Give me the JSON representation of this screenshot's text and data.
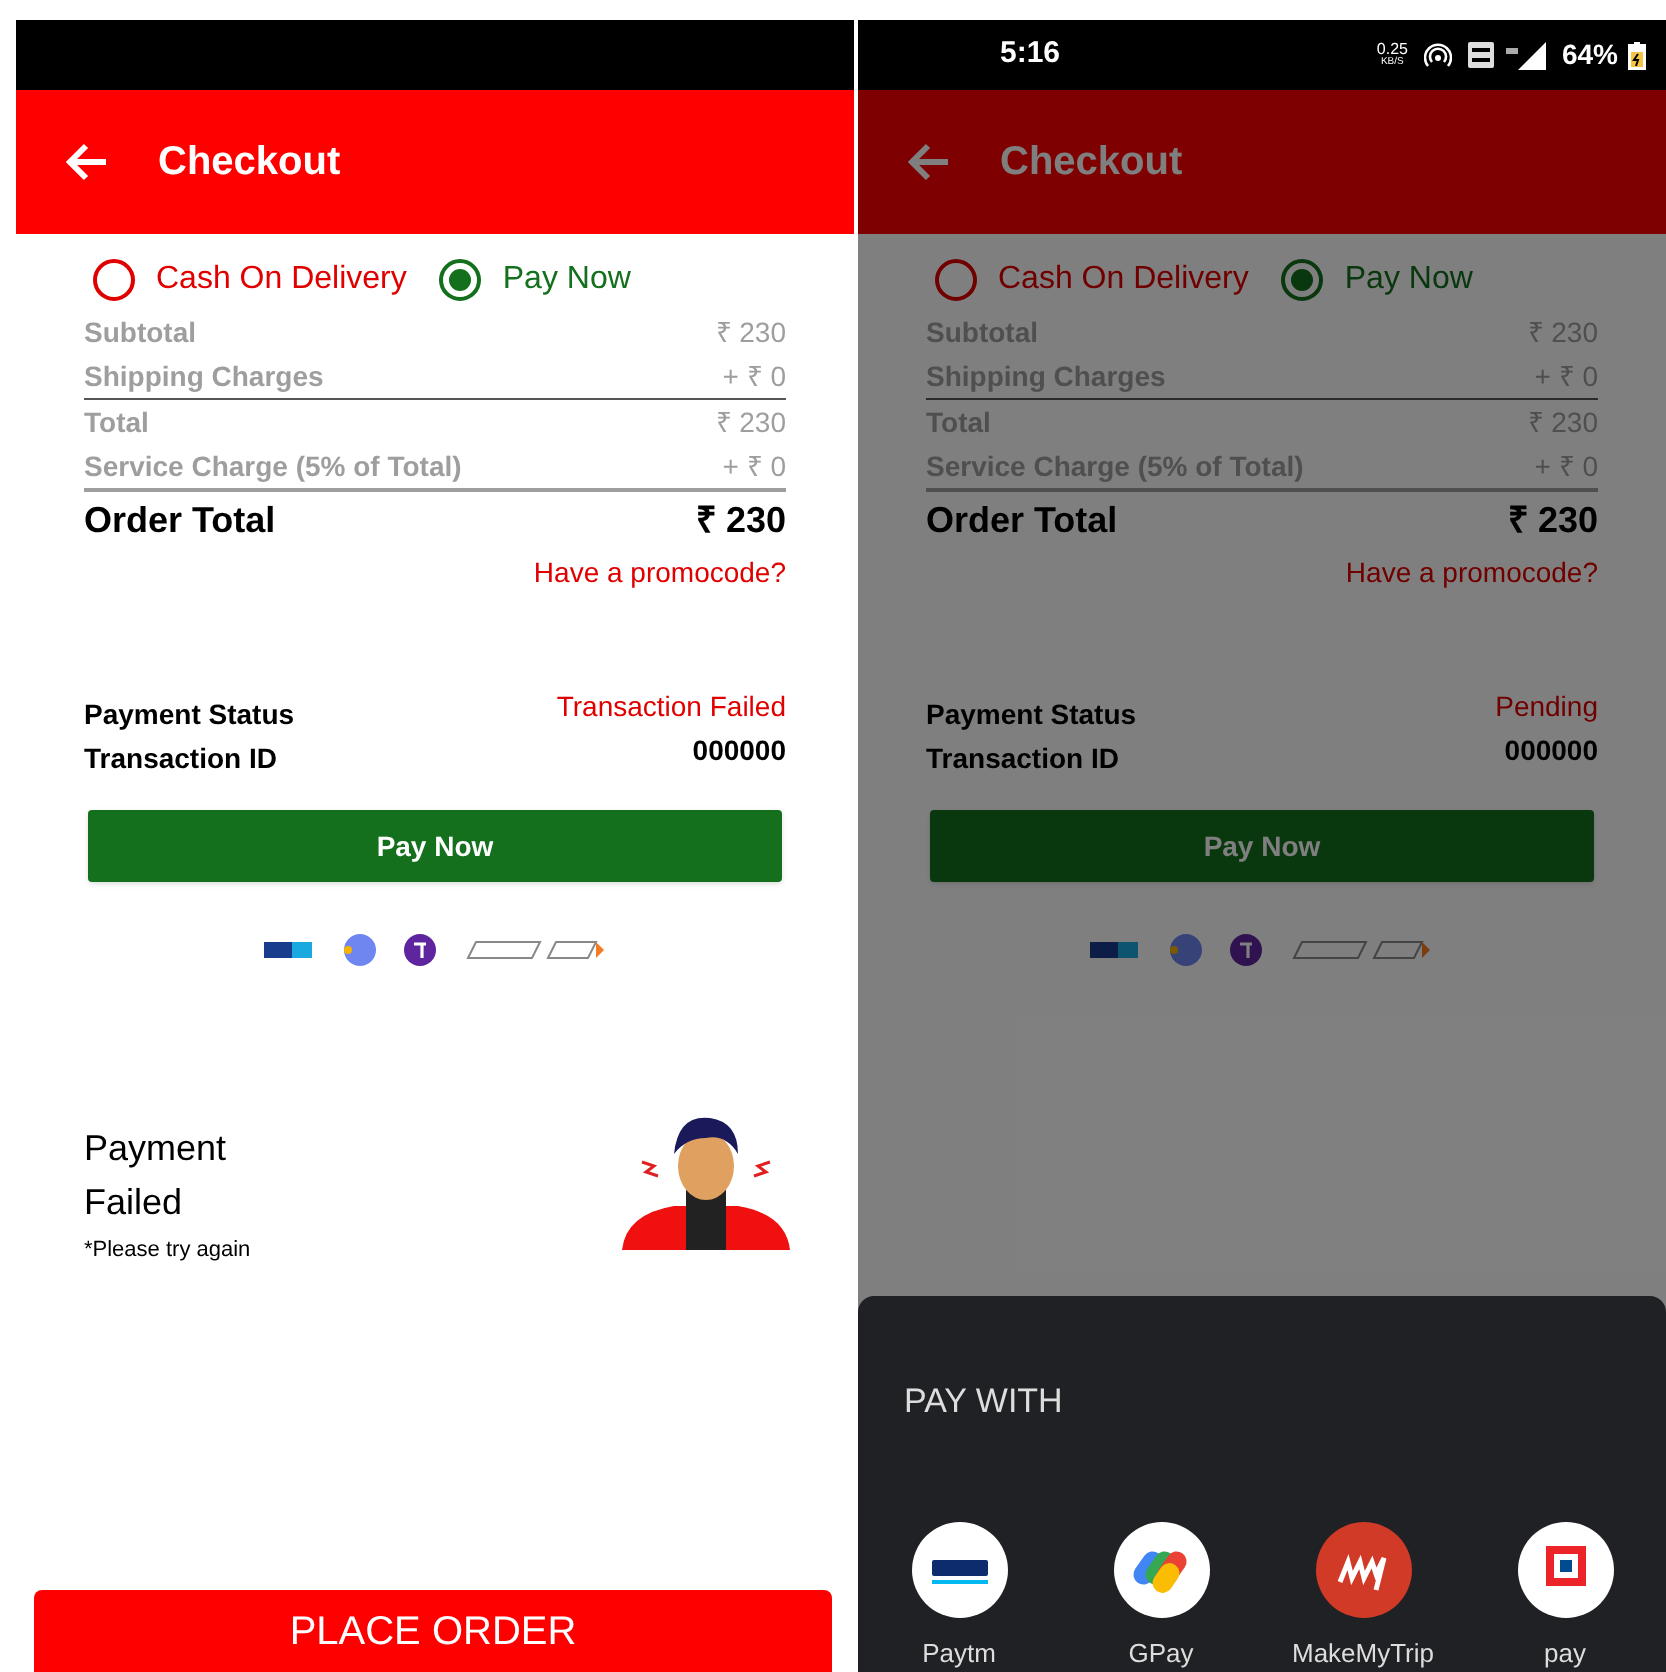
{
  "screens": [
    {
      "header": {
        "title": "Checkout"
      },
      "payment_options": [
        {
          "label": "Cash On Delivery",
          "selected": false
        },
        {
          "label": "Pay Now",
          "selected": true
        }
      ],
      "summary_groups": [
        [
          {
            "label": "Subtotal",
            "value": "₹ 230"
          },
          {
            "label": "Shipping Charges",
            "value": "+ ₹ 0"
          }
        ],
        [
          {
            "label": "Total",
            "value": "₹ 230"
          },
          {
            "label": "Service Charge (5% of Total)",
            "value": "+ ₹ 0"
          }
        ]
      ],
      "order_total": {
        "label": "Order Total",
        "value": "₹ 230"
      },
      "promo_link": "Have a promocode?",
      "details": [
        {
          "label": "Payment Status",
          "value": "Transaction Failed",
          "kind": "status"
        },
        {
          "label": "Transaction ID",
          "value": "000000",
          "kind": "plain"
        }
      ],
      "pay_button": "Pay Now",
      "failure": {
        "title": "Payment Failed",
        "note": "*Please try again"
      },
      "place_order_button": "PLACE ORDER"
    },
    {
      "status_bar": {
        "time": "5:16",
        "speed": "0.25",
        "speed_unit": "KB/S",
        "battery": "64%"
      },
      "header": {
        "title": "Checkout"
      },
      "payment_options": [
        {
          "label": "Cash On Delivery",
          "selected": false
        },
        {
          "label": "Pay Now",
          "selected": true
        }
      ],
      "summary_groups": [
        [
          {
            "label": "Subtotal",
            "value": "₹ 230"
          },
          {
            "label": "Shipping Charges",
            "value": "+ ₹ 0"
          }
        ],
        [
          {
            "label": "Total",
            "value": "₹ 230"
          },
          {
            "label": "Service Charge (5% of Total)",
            "value": "+ ₹ 0"
          }
        ]
      ],
      "order_total": {
        "label": "Order Total",
        "value": "₹ 230"
      },
      "promo_link": "Have a promocode?",
      "details": [
        {
          "label": "Payment Status",
          "value": "Pending",
          "kind": "status"
        },
        {
          "label": "Transaction ID",
          "value": "000000",
          "kind": "plain"
        }
      ],
      "pay_button": "Pay Now",
      "sheet": {
        "title": "PAY WITH",
        "apps": [
          {
            "label": "Paytm",
            "kind": "paytm"
          },
          {
            "label": "GPay",
            "kind": "gpay"
          },
          {
            "label": "MakeMyTrip",
            "kind": "mmt"
          },
          {
            "label": "pay",
            "kind": "bank"
          }
        ]
      }
    }
  ]
}
